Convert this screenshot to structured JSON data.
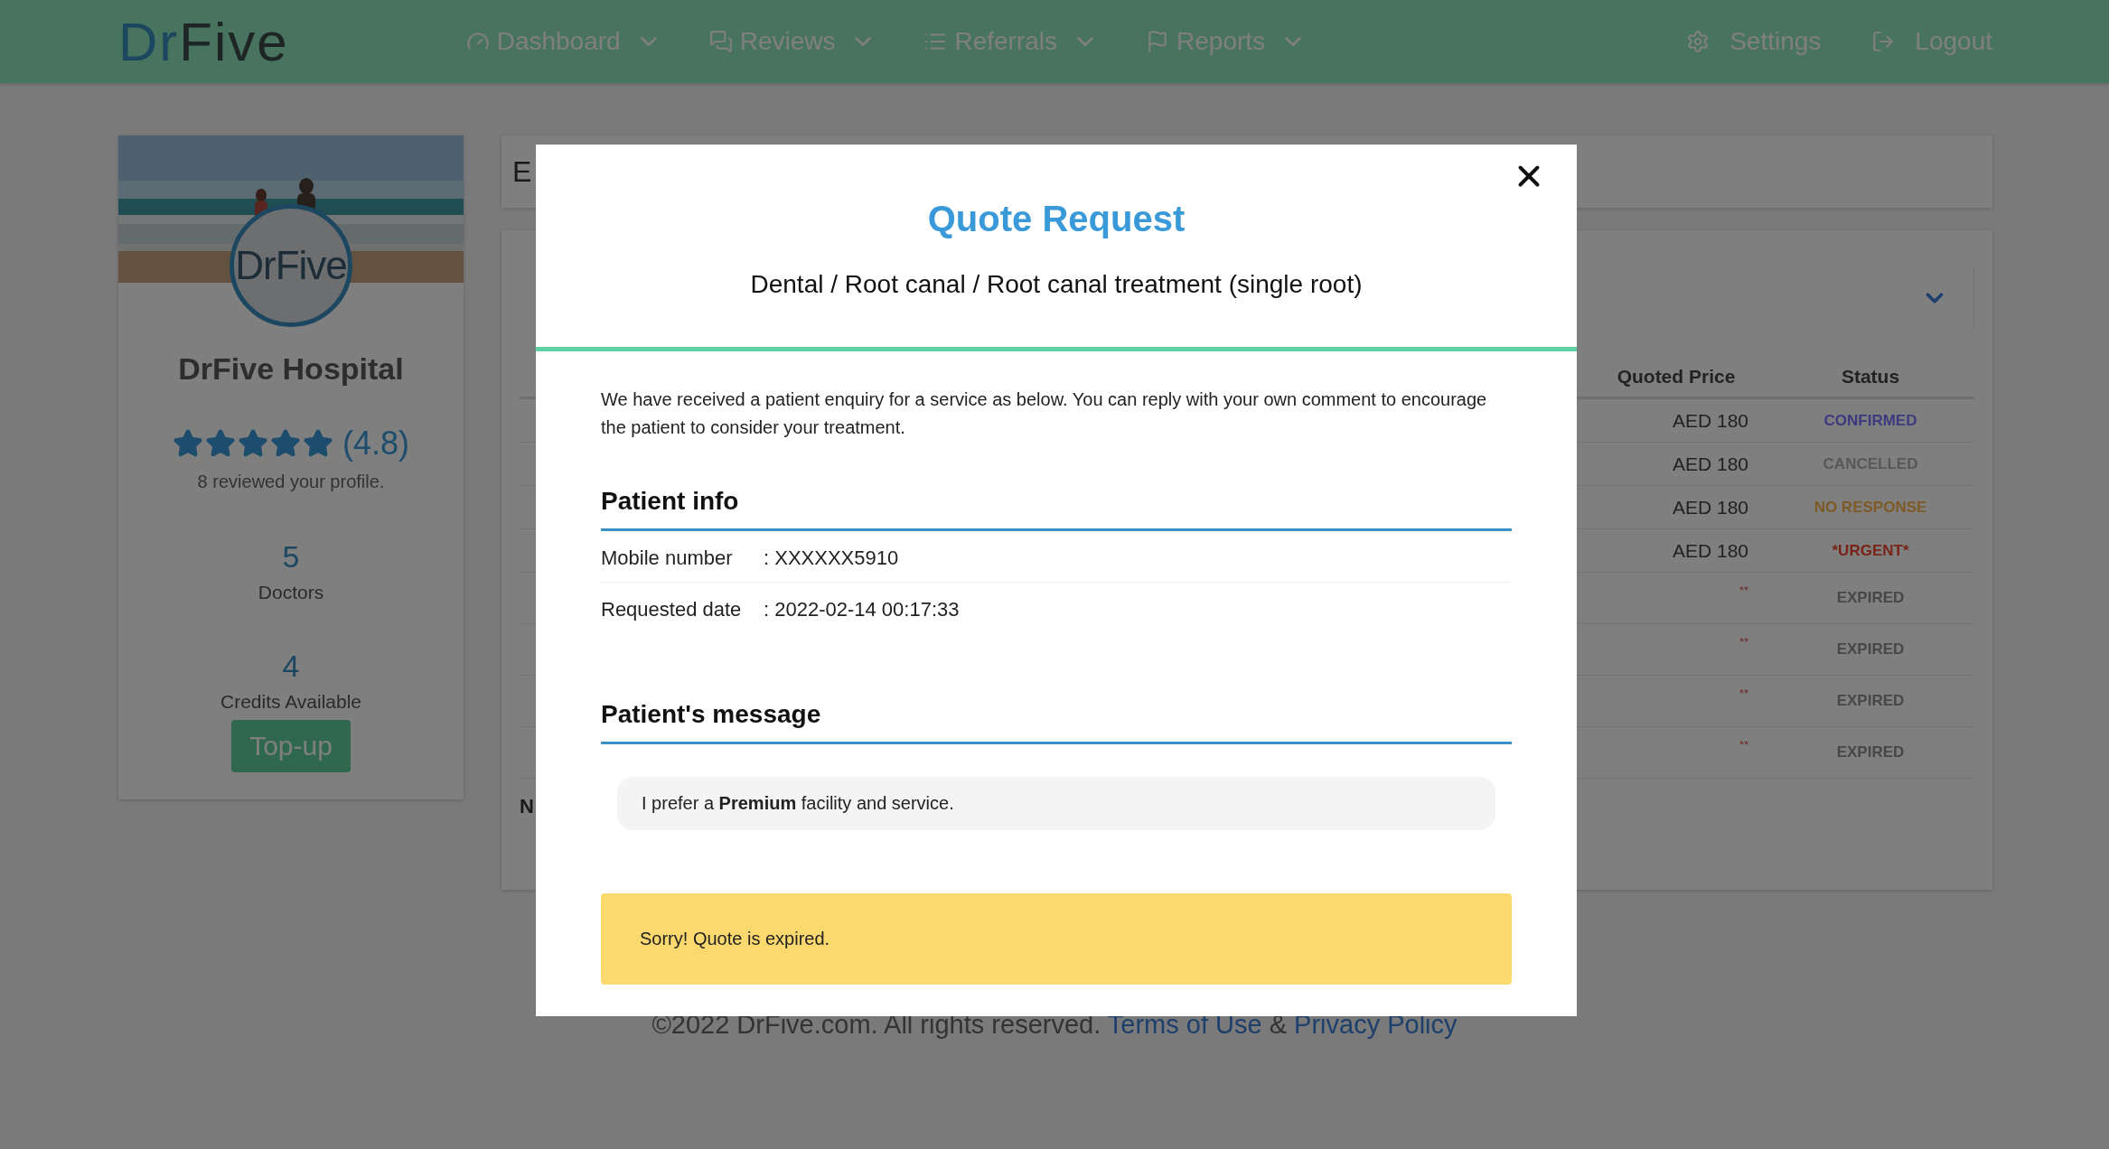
{
  "navbar": {
    "logo": {
      "part_1": "Dr",
      "part_2": "Five"
    },
    "menu": [
      {
        "label": "Dashboard",
        "kind": "gauge"
      },
      {
        "label": "Reviews",
        "kind": "comments"
      },
      {
        "label": "Referrals",
        "kind": "list"
      },
      {
        "label": "Reports",
        "kind": "flag"
      }
    ],
    "right": [
      {
        "label": "Settings",
        "kind": "gear"
      },
      {
        "label": "Logout",
        "kind": "logout"
      }
    ]
  },
  "profile": {
    "avatar_text": "DrFive",
    "name": "DrFive Hospital",
    "stars": 5,
    "rating": "(4.8)",
    "reviews": "8 reviewed your profile.",
    "stats": [
      {
        "value": "5",
        "label": "Doctors"
      },
      {
        "value": "4",
        "label": "Credits Available"
      }
    ],
    "button": "Top-up"
  },
  "content": {
    "heading": "E",
    "note": "N",
    "table": {
      "columns": [
        "Quoted Price",
        "Status"
      ],
      "rows": [
        {
          "kind": "amount",
          "price": "AED 180",
          "status": "CONFIRMED",
          "color": "#3e3a80"
        },
        {
          "kind": "amount",
          "price": "AED 180",
          "status": "CANCELLED",
          "color": "#585858"
        },
        {
          "kind": "amount",
          "price": "AED 180",
          "status": "NO RESPONSE",
          "color": "#7e5a26"
        },
        {
          "kind": "amount",
          "price": "AED 180",
          "status": "*URGENT*",
          "color": "#7a2418"
        },
        {
          "kind": "pending",
          "price": "**",
          "status": "EXPIRED",
          "color": "#474747"
        },
        {
          "kind": "pending",
          "price": "**",
          "status": "EXPIRED",
          "color": "#474747"
        },
        {
          "kind": "pending",
          "price": "**",
          "status": "EXPIRED",
          "color": "#474747"
        },
        {
          "kind": "pending",
          "price": "**",
          "status": "EXPIRED",
          "color": "#474747"
        }
      ]
    }
  },
  "footer": {
    "text": "©2022 DrFive.com. All rights reserved.",
    "link_1": "Terms of Use",
    "joiner": "&",
    "link_2": "Privacy Policy"
  },
  "modal": {
    "title": "Quote Request",
    "subtitle": "Dental / Root canal / Root canal treatment (single root)",
    "intro": "We have received a patient enquiry for a service as below. You can reply with your own comment to encourage the patient to consider your treatment.",
    "info_heading": "Patient info",
    "info": [
      {
        "label": "Mobile number",
        "value": ": XXXXXX5910"
      },
      {
        "label": "Requested date",
        "value": ": 2022-02-14 00:17:33"
      }
    ],
    "message_heading": "Patient's message",
    "message": "I prefer a **Premium** facility and service.",
    "alert": "Sorry! Quote is expired."
  }
}
